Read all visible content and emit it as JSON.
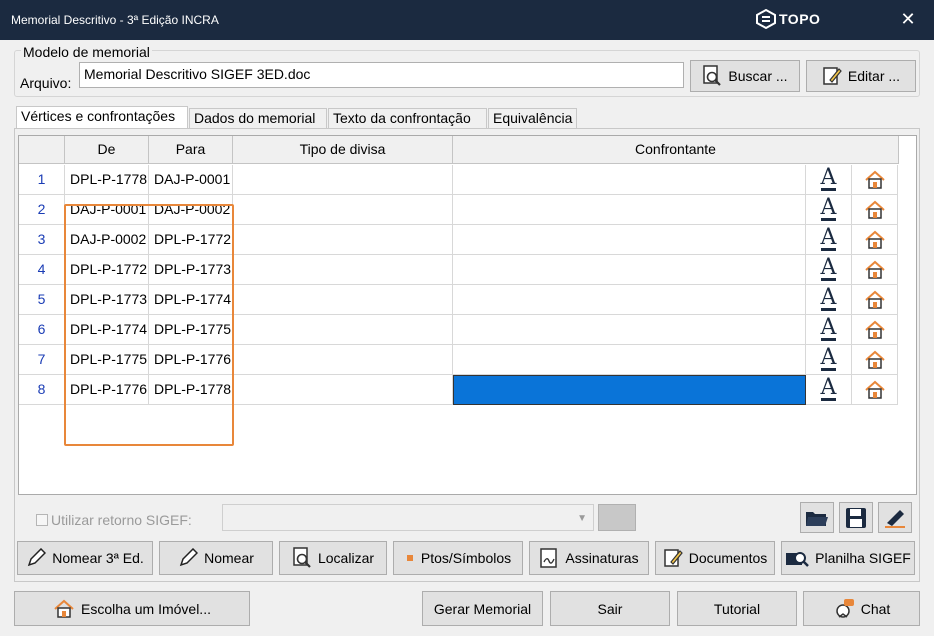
{
  "window": {
    "title": "Memorial Descritivo - 3ª Edição INCRA",
    "brand": "TOPO",
    "close_glyph": "✕"
  },
  "model": {
    "legend": "Modelo de memorial",
    "arquivo_label": "Arquivo:",
    "arquivo_value": "Memorial Descritivo SIGEF 3ED.doc",
    "buscar_label": "Buscar ...",
    "editar_label": "Editar ..."
  },
  "tabs": [
    {
      "label": "Vértices e confrontações",
      "active": true
    },
    {
      "label": "Dados do memorial",
      "active": false
    },
    {
      "label": "Texto da confrontação",
      "active": false
    },
    {
      "label": "Equivalência",
      "active": false
    }
  ],
  "grid": {
    "columns": [
      "De",
      "Para",
      "Tipo de divisa",
      "Confrontante"
    ],
    "rows": [
      {
        "num": "1",
        "de": "DPL-P-1778",
        "para": "DAJ-P-0001",
        "tipo": "",
        "confrontante": ""
      },
      {
        "num": "2",
        "de": "DAJ-P-0001",
        "para": "DAJ-P-0002",
        "tipo": "",
        "confrontante": ""
      },
      {
        "num": "3",
        "de": "DAJ-P-0002",
        "para": "DPL-P-1772",
        "tipo": "",
        "confrontante": ""
      },
      {
        "num": "4",
        "de": "DPL-P-1772",
        "para": "DPL-P-1773",
        "tipo": "",
        "confrontante": ""
      },
      {
        "num": "5",
        "de": "DPL-P-1773",
        "para": "DPL-P-1774",
        "tipo": "",
        "confrontante": ""
      },
      {
        "num": "6",
        "de": "DPL-P-1774",
        "para": "DPL-P-1775",
        "tipo": "",
        "confrontante": ""
      },
      {
        "num": "7",
        "de": "DPL-P-1775",
        "para": "DPL-P-1776",
        "tipo": "",
        "confrontante": ""
      },
      {
        "num": "8",
        "de": "DPL-P-1776",
        "para": "DPL-P-1778",
        "tipo": "",
        "confrontante": ""
      }
    ],
    "text_icon_glyph": "A",
    "selected_row": 8,
    "selection_color": "#0a74d8",
    "highlight_color": "#e8873a"
  },
  "sigef": {
    "checkbox_label": "Utilizar retorno SIGEF:",
    "checked": false,
    "combo_value": ""
  },
  "actions": {
    "nomear3": "Nomear 3ª Ed.",
    "nomear": "Nomear",
    "localizar": "Localizar",
    "ptos": "Ptos/Símbolos",
    "assinaturas": "Assinaturas",
    "documentos": "Documentos",
    "planilha": "Planilha SIGEF"
  },
  "footer": {
    "escolha": "Escolha um Imóvel...",
    "gerar": "Gerar Memorial",
    "sair": "Sair",
    "tutorial": "Tutorial",
    "chat": "Chat"
  }
}
